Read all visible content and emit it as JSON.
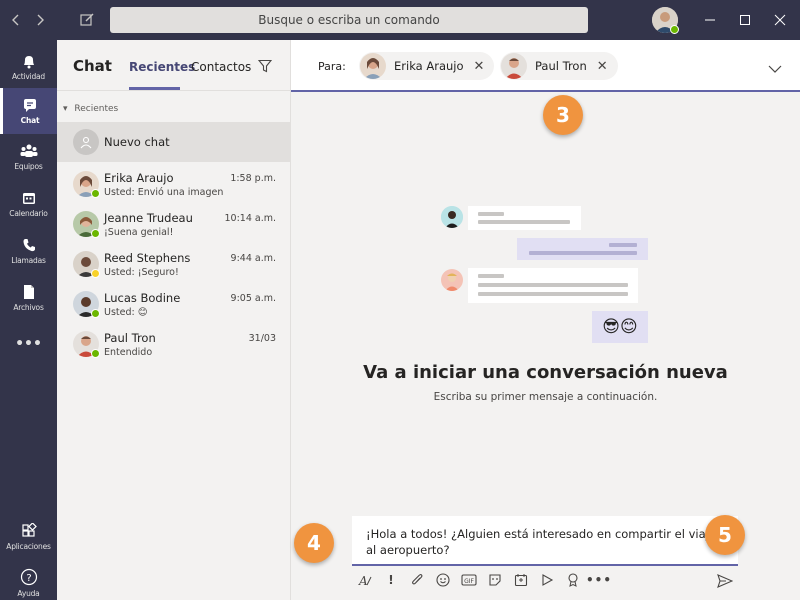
{
  "titlebar": {
    "search_placeholder": "Busque o escriba un comando"
  },
  "rail": {
    "items": [
      {
        "label": "Actividad",
        "icon": "bell-icon"
      },
      {
        "label": "Chat",
        "icon": "chat-icon"
      },
      {
        "label": "Equipos",
        "icon": "teams-icon"
      },
      {
        "label": "Calendario",
        "icon": "calendar-icon"
      },
      {
        "label": "Llamadas",
        "icon": "phone-icon"
      },
      {
        "label": "Archivos",
        "icon": "file-icon"
      },
      {
        "label": "Aplicaciones",
        "icon": "apps-icon"
      },
      {
        "label": "Ayuda",
        "icon": "help-icon"
      }
    ],
    "more": "•••"
  },
  "list": {
    "title": "Chat",
    "tabs": [
      "Recientes",
      "Contactos"
    ],
    "section": "Recientes",
    "new_chat": "Nuevo chat",
    "chats": [
      {
        "name": "Erika Araujo",
        "preview": "Usted: Envió una imagen",
        "time": "1:58 p.m."
      },
      {
        "name": "Jeanne Trudeau",
        "preview": "¡Suena genial!",
        "time": "10:14 a.m."
      },
      {
        "name": "Reed Stephens",
        "preview": "Usted: ¡Seguro!",
        "time": "9:44 a.m."
      },
      {
        "name": "Lucas Bodine",
        "preview": "Usted: 😊",
        "time": "9:05 a.m."
      },
      {
        "name": "Paul Tron",
        "preview": "Entendido",
        "time": "31/03"
      }
    ]
  },
  "compose_to": {
    "label": "Para:",
    "recipients": [
      "Erika Araujo",
      "Paul Tron"
    ]
  },
  "empty_state": {
    "title": "Va a iniciar una conversación nueva",
    "subtitle": "Escriba su primer mensaje a continuación.",
    "emojis": "😎😊"
  },
  "compose": {
    "text": "¡Hola a todos! ¿Alguien está interesado en compartir el viaje al aeropuerto?"
  },
  "callouts": {
    "three": "3",
    "four": "4",
    "five": "5"
  },
  "colors": {
    "accent": "#6264a7",
    "rail": "#33344a",
    "callout": "#f0943f"
  }
}
